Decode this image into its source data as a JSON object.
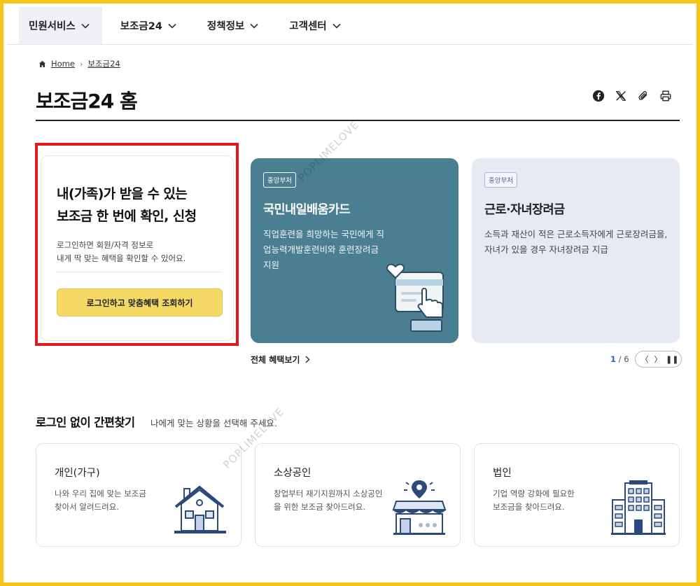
{
  "nav": {
    "items": [
      {
        "label": "민원서비스"
      },
      {
        "label": "보조금24"
      },
      {
        "label": "정책정보"
      },
      {
        "label": "고객센터"
      }
    ]
  },
  "breadcrumb": {
    "home": "Home",
    "current": "보조금24"
  },
  "page_title": "보조금24 홈",
  "login_card": {
    "heading_line1": "내(가족)가 받을 수 있는",
    "heading_line2": "보조금 한 번에 확인, 신청",
    "desc_line1": "로그인하면 회원/자격 정보로",
    "desc_line2": "내게 딱 맞는 혜택을 확인할 수 있어요.",
    "button": "로그인하고 맞춤혜택 조회하기"
  },
  "slides": [
    {
      "badge": "중앙부처",
      "title": "국민내일배움카드",
      "desc": "직업훈련을 희망하는 국민에게 직업능력개발훈련비와 훈련장려금 지원"
    },
    {
      "badge": "중앙부처",
      "title": "근로·자녀장려금",
      "desc": "소득과 재산이 적은 근로소득자에게 근로장려금을, 자녀가 있을 경우 자녀장려금 지급"
    }
  ],
  "all_benefits_link": "전체 혜택보기",
  "pager": {
    "current": "1",
    "total": "/ 6",
    "prev": "〈",
    "next": "〉",
    "pause": "❚❚"
  },
  "quick": {
    "title": "로그인 없이 간편찾기",
    "subtitle": "나에게 맞는 상황을 선택해 주세요.",
    "cards": [
      {
        "title": "개인(가구)",
        "desc_line1": "나와 우리 집에 맞는 보조금",
        "desc_line2": "찾아서 알려드려요."
      },
      {
        "title": "소상공인",
        "desc_line1": "창업부터 재기지원까지 소상공인",
        "desc_line2": "을 위한 보조금 찾아드려요."
      },
      {
        "title": "법인",
        "desc_line1": "기업 역량 강화에 필요한",
        "desc_line2": "보조금을 찾아드려요."
      }
    ]
  },
  "watermark": "POPLIMELOVE",
  "colors": {
    "frame": "#f5c518",
    "highlight": "#e01a1a",
    "button": "#f6d964",
    "teal_card": "#4a7f91",
    "light_card": "#e7eaf2",
    "pager_active": "#2e5ec3"
  }
}
